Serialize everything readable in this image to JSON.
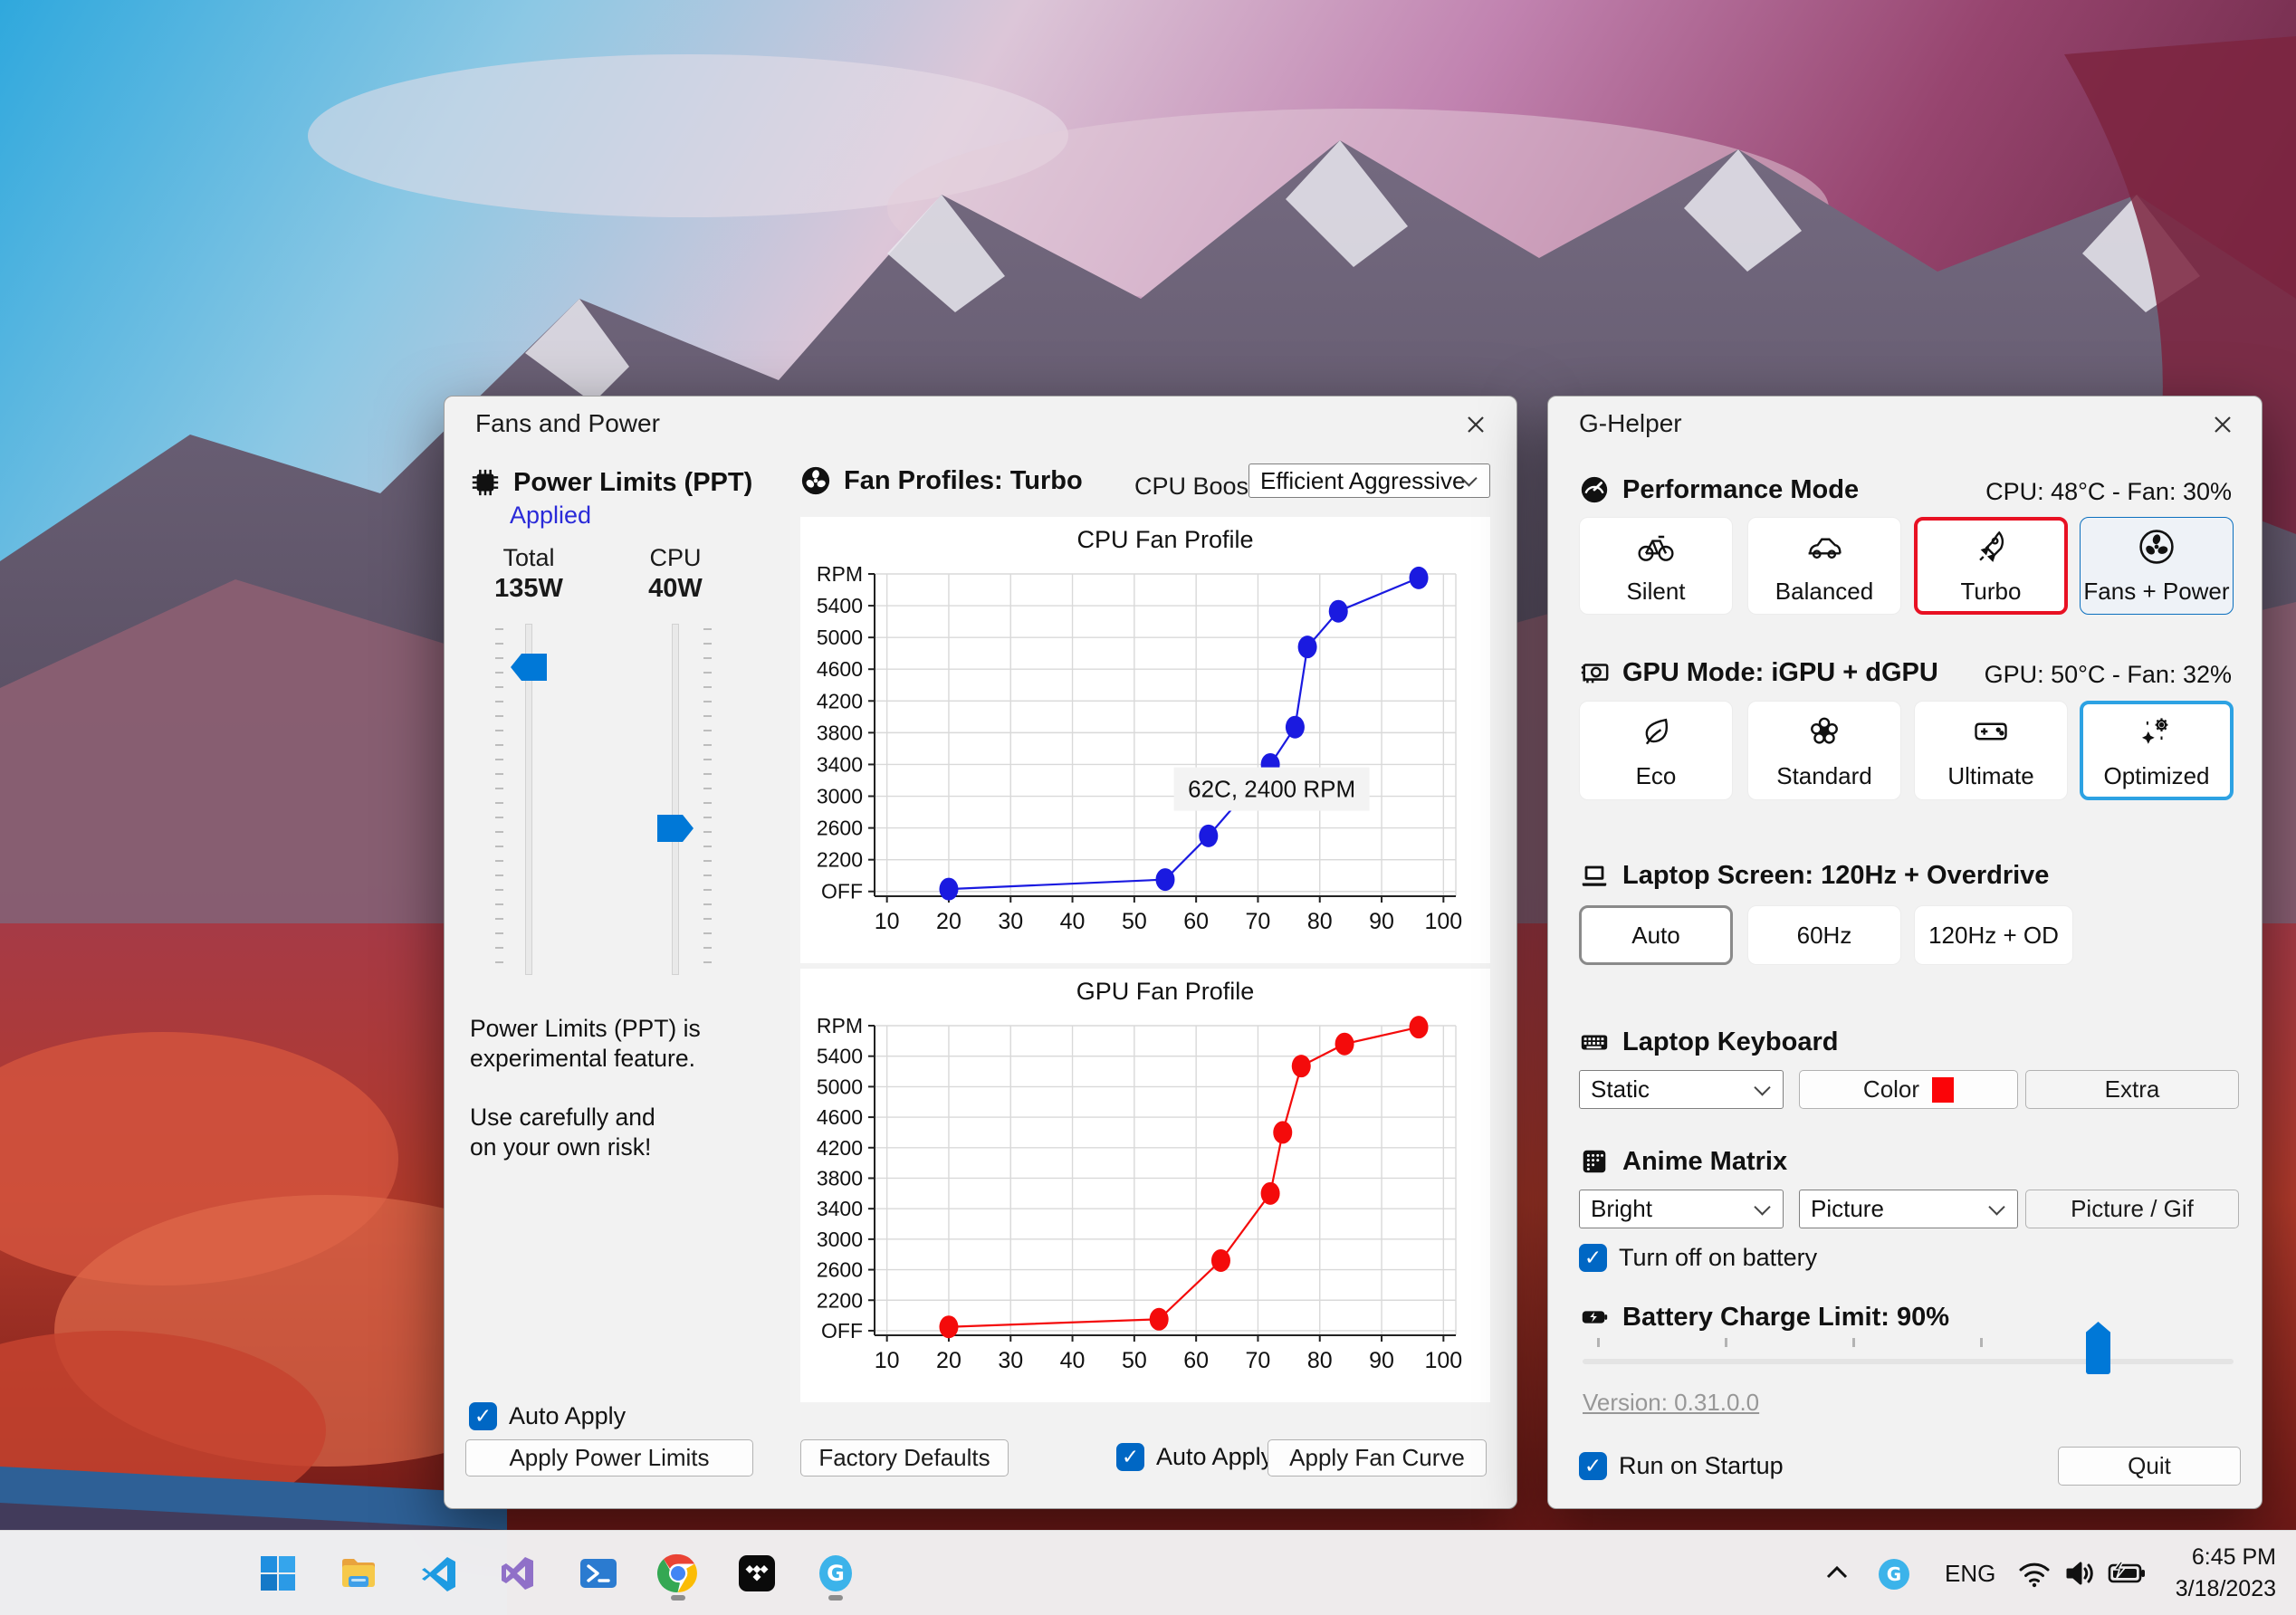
{
  "fans_window": {
    "title": "Fans and Power",
    "power_limits": {
      "heading": "Power Limits (PPT)",
      "status": "Applied",
      "sliders": [
        {
          "label": "Total",
          "value": "135W"
        },
        {
          "label": "CPU",
          "value": "40W"
        }
      ],
      "note_lines": [
        "Power Limits (PPT) is",
        "experimental feature.",
        "Use carefully and",
        "on your own risk!"
      ],
      "auto_apply": "Auto Apply",
      "apply_button": "Apply Power Limits"
    },
    "fan_profiles": {
      "heading": "Fan Profiles: Turbo",
      "cpu_boost_label": "CPU Boost",
      "cpu_boost_value": "Efficient Aggressive",
      "factory_defaults": "Factory Defaults",
      "auto_apply": "Auto Apply",
      "apply_button": "Apply Fan Curve"
    }
  },
  "chart_data": [
    {
      "type": "line",
      "title": "CPU Fan Profile",
      "series": [
        {
          "name": "CPU fan curve",
          "color": "#1a1ae0",
          "x": [
            20,
            55,
            62,
            72,
            76,
            78,
            83,
            96
          ],
          "y": [
            1830,
            1950,
            2500,
            3400,
            3870,
            4880,
            5330,
            5750
          ]
        }
      ],
      "xticks": [
        10,
        20,
        30,
        40,
        50,
        60,
        70,
        80,
        90,
        100
      ],
      "xlim": [
        8,
        102
      ],
      "ytick_values": [
        1800,
        2200,
        2600,
        3000,
        3400,
        3800,
        4200,
        4600,
        5000,
        5400,
        5800
      ],
      "ytick_labels": [
        "OFF",
        "2200",
        "2600",
        "3000",
        "3400",
        "3800",
        "4200",
        "4600",
        "5000",
        "5400",
        "RPM"
      ],
      "ylim": [
        1740,
        5800
      ],
      "grid": true,
      "legend": "none",
      "xlabel": "",
      "ylabel": "RPM",
      "tooltip": "62C, 2400 RPM"
    },
    {
      "type": "line",
      "title": "GPU Fan Profile",
      "series": [
        {
          "name": "GPU fan curve",
          "color": "#f40b0b",
          "x": [
            20,
            54,
            64,
            72,
            74,
            77,
            84,
            96
          ],
          "y": [
            1850,
            1950,
            2720,
            3600,
            4400,
            5270,
            5560,
            5780
          ]
        }
      ],
      "xticks": [
        10,
        20,
        30,
        40,
        50,
        60,
        70,
        80,
        90,
        100
      ],
      "xlim": [
        8,
        102
      ],
      "ytick_values": [
        1800,
        2200,
        2600,
        3000,
        3400,
        3800,
        4200,
        4600,
        5000,
        5400,
        5800
      ],
      "ytick_labels": [
        "OFF",
        "2200",
        "2600",
        "3000",
        "3400",
        "3800",
        "4200",
        "4600",
        "5000",
        "5400",
        "RPM"
      ],
      "ylim": [
        1740,
        5800
      ],
      "grid": true,
      "legend": "none",
      "xlabel": "",
      "ylabel": "RPM"
    }
  ],
  "ghelper": {
    "title": "G-Helper",
    "performance": {
      "heading": "Performance Mode",
      "status": "CPU: 48°C -  Fan: 30%",
      "buttons": [
        {
          "label": "Silent",
          "icon": "bicycle-icon"
        },
        {
          "label": "Balanced",
          "icon": "car-icon"
        },
        {
          "label": "Turbo",
          "icon": "rocket-icon",
          "selected": true
        },
        {
          "label": "Fans + Power",
          "icon": "fan-icon",
          "highlighted": true
        }
      ]
    },
    "gpu": {
      "heading": "GPU Mode: iGPU + dGPU",
      "status": "GPU: 50°C -  Fan: 32%",
      "buttons": [
        {
          "label": "Eco",
          "icon": "leaf-icon"
        },
        {
          "label": "Standard",
          "icon": "flower-icon"
        },
        {
          "label": "Ultimate",
          "icon": "gamepad-icon"
        },
        {
          "label": "Optimized",
          "icon": "sparkle-gear-icon",
          "selected": true
        }
      ]
    },
    "screen": {
      "heading": "Laptop Screen: 120Hz + Overdrive",
      "buttons": [
        {
          "label": "Auto",
          "selected": true
        },
        {
          "label": "60Hz"
        },
        {
          "label": "120Hz + OD"
        }
      ]
    },
    "keyboard": {
      "heading": "Laptop Keyboard",
      "mode_value": "Static",
      "color_button": "Color",
      "color_swatch": "#fb0408",
      "extra_button": "Extra"
    },
    "matrix": {
      "heading": "Anime Matrix",
      "brightness_value": "Bright",
      "mode_value": "Picture",
      "picture_button": "Picture / Gif",
      "battery_checkbox": "Turn off on battery"
    },
    "battery": {
      "heading": "Battery Charge Limit: 90%",
      "percent_label": "90%"
    },
    "version_link": "Version: 0.31.0.0",
    "startup_checkbox": "Run on Startup",
    "quit_button": "Quit"
  },
  "taskbar": {
    "icons": [
      "start-icon",
      "file-explorer-icon",
      "vscode-icon",
      "visual-studio-icon",
      "powershell-icon",
      "chrome-icon",
      "tidal-icon",
      "ghelper-icon"
    ],
    "tray": {
      "hidden_icons": "chevron-up-icon",
      "ghelper_tray": "ghelper-tray-icon",
      "language": "ENG",
      "network": "wifi-icon",
      "sound": "volume-icon",
      "power": "battery-icon",
      "time": "6:45 PM",
      "date": "3/18/2023"
    }
  }
}
